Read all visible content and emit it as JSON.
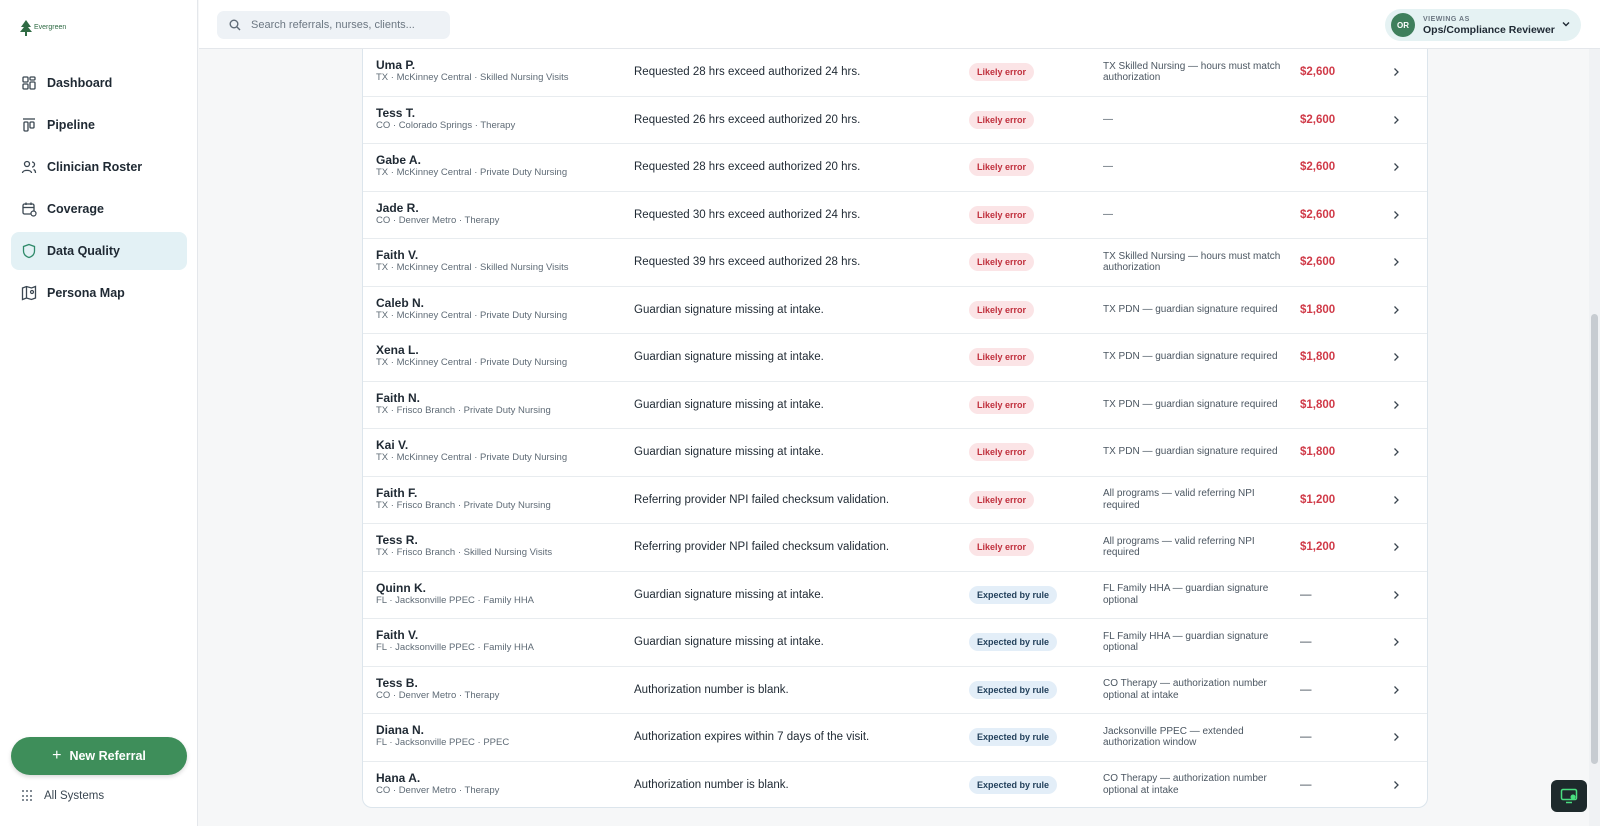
{
  "app": {
    "logo_text": "Evergreen"
  },
  "sidebar": {
    "items": [
      {
        "label": "Dashboard",
        "icon": "dashboard-icon",
        "active": false
      },
      {
        "label": "Pipeline",
        "icon": "pipeline-icon",
        "active": false
      },
      {
        "label": "Clinician Roster",
        "icon": "users-icon",
        "active": false
      },
      {
        "label": "Coverage",
        "icon": "calendar-icon",
        "active": false
      },
      {
        "label": "Data Quality",
        "icon": "shield-icon",
        "active": true
      },
      {
        "label": "Persona Map",
        "icon": "map-icon",
        "active": false
      }
    ],
    "new_referral": "New Referral",
    "all_systems": "All Systems"
  },
  "topbar": {
    "search_placeholder": "Search referrals, nurses, clients...",
    "viewer_label": "VIEWING AS",
    "viewer_name": "Ops/Compliance Reviewer",
    "avatar_initials": "OR"
  },
  "rows": [
    {
      "name": "Uma P.",
      "meta": "TX · McKinney Central · Skilled Nursing Visits",
      "issue": "Requested 28 hrs exceed authorized 24 hrs.",
      "badge": "Likely error",
      "badge_type": "err",
      "rule": "TX Skilled Nursing — hours must match authorization",
      "amount": "$2,600"
    },
    {
      "name": "Tess T.",
      "meta": "CO · Colorado Springs · Therapy",
      "issue": "Requested 26 hrs exceed authorized 20 hrs.",
      "badge": "Likely error",
      "badge_type": "err",
      "rule": "—",
      "amount": "$2,600"
    },
    {
      "name": "Gabe A.",
      "meta": "TX · McKinney Central · Private Duty Nursing",
      "issue": "Requested 28 hrs exceed authorized 20 hrs.",
      "badge": "Likely error",
      "badge_type": "err",
      "rule": "—",
      "amount": "$2,600"
    },
    {
      "name": "Jade R.",
      "meta": "CO · Denver Metro · Therapy",
      "issue": "Requested 30 hrs exceed authorized 24 hrs.",
      "badge": "Likely error",
      "badge_type": "err",
      "rule": "—",
      "amount": "$2,600"
    },
    {
      "name": "Faith V.",
      "meta": "TX · McKinney Central · Skilled Nursing Visits",
      "issue": "Requested 39 hrs exceed authorized 28 hrs.",
      "badge": "Likely error",
      "badge_type": "err",
      "rule": "TX Skilled Nursing — hours must match authorization",
      "amount": "$2,600"
    },
    {
      "name": "Caleb N.",
      "meta": "TX · McKinney Central · Private Duty Nursing",
      "issue": "Guardian signature missing at intake.",
      "badge": "Likely error",
      "badge_type": "err",
      "rule": "TX PDN — guardian signature required",
      "amount": "$1,800"
    },
    {
      "name": "Xena L.",
      "meta": "TX · McKinney Central · Private Duty Nursing",
      "issue": "Guardian signature missing at intake.",
      "badge": "Likely error",
      "badge_type": "err",
      "rule": "TX PDN — guardian signature required",
      "amount": "$1,800"
    },
    {
      "name": "Faith N.",
      "meta": "TX · Frisco Branch · Private Duty Nursing",
      "issue": "Guardian signature missing at intake.",
      "badge": "Likely error",
      "badge_type": "err",
      "rule": "TX PDN — guardian signature required",
      "amount": "$1,800"
    },
    {
      "name": "Kai V.",
      "meta": "TX · McKinney Central · Private Duty Nursing",
      "issue": "Guardian signature missing at intake.",
      "badge": "Likely error",
      "badge_type": "err",
      "rule": "TX PDN — guardian signature required",
      "amount": "$1,800"
    },
    {
      "name": "Faith F.",
      "meta": "TX · Frisco Branch · Private Duty Nursing",
      "issue": "Referring provider NPI failed checksum validation.",
      "badge": "Likely error",
      "badge_type": "err",
      "rule": "All programs — valid referring NPI required",
      "amount": "$1,200"
    },
    {
      "name": "Tess R.",
      "meta": "TX · Frisco Branch · Skilled Nursing Visits",
      "issue": "Referring provider NPI failed checksum validation.",
      "badge": "Likely error",
      "badge_type": "err",
      "rule": "All programs — valid referring NPI required",
      "amount": "$1,200"
    },
    {
      "name": "Quinn K.",
      "meta": "FL · Jacksonville PPEC · Family HHA",
      "issue": "Guardian signature missing at intake.",
      "badge": "Expected by rule",
      "badge_type": "exp",
      "rule": "FL Family HHA — guardian signature optional",
      "amount": "—"
    },
    {
      "name": "Faith V.",
      "meta": "FL · Jacksonville PPEC · Family HHA",
      "issue": "Guardian signature missing at intake.",
      "badge": "Expected by rule",
      "badge_type": "exp",
      "rule": "FL Family HHA — guardian signature optional",
      "amount": "—"
    },
    {
      "name": "Tess B.",
      "meta": "CO · Denver Metro · Therapy",
      "issue": "Authorization number is blank.",
      "badge": "Expected by rule",
      "badge_type": "exp",
      "rule": "CO Therapy — authorization number optional at intake",
      "amount": "—"
    },
    {
      "name": "Diana N.",
      "meta": "FL · Jacksonville PPEC · PPEC",
      "issue": "Authorization expires within 7 days of the visit.",
      "badge": "Expected by rule",
      "badge_type": "exp",
      "rule": "Jacksonville PPEC — extended authorization window",
      "amount": "—"
    },
    {
      "name": "Hana A.",
      "meta": "CO · Denver Metro · Therapy",
      "issue": "Authorization number is blank.",
      "badge": "Expected by rule",
      "badge_type": "exp",
      "rule": "CO Therapy — authorization number optional at intake",
      "amount": "—"
    }
  ]
}
